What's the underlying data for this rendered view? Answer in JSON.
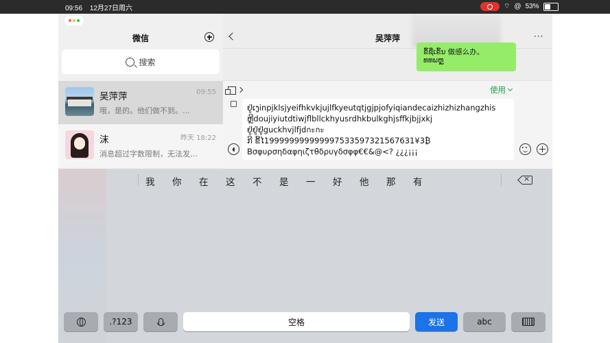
{
  "status_bar": {
    "time": "09:56",
    "date": "12月27日周六",
    "battery": "53%",
    "battery_level": 0.53
  },
  "left_pane": {
    "title": "微信",
    "search_placeholder": "搜索",
    "chats": [
      {
        "name": "吴萍萍",
        "time": "09:55",
        "message": "哦，是的。他们做不到。…",
        "selected": true
      },
      {
        "name": "沫",
        "time": "昨天 18:22",
        "message": "消息超过字数限制，无法发…",
        "selected": false
      }
    ]
  },
  "conversation": {
    "title": "吴萍萍",
    "bubble_lines": [
      "ຂຶ້ຊື່ເຂົ້ນ  做感么办。",
      "ທທພຫຼຼຼຼຼ"
    ],
    "use_label": "使用",
    "input_lines": [
      "ຢູ່ເງinpjklsjyeifhkvkjujlfkyeutqtjgjpjofyiqiandecaizhizhizhangzhis",
      "ຫຼີdoujiyiutdtiwjflbllckhyusrdhkbulkghjsffkjbjjxkj",
      "ຢູ່ຢູ່ຢູ່guckhvjlfjdกะกะ",
      "ກີ ຂີ້ໄ1999999999999975335973215676​31¥3₿",
      "Βσφυρσηδαφηιζτθδρυγδσφφ€€&@<?  ¿¿¿¡¡¡"
    ]
  },
  "keyboard": {
    "candidates": [
      "我",
      "你",
      "在",
      "这",
      "不",
      "是",
      "一",
      "好",
      "他",
      "那",
      "有"
    ],
    "num_key": ".?123",
    "space_key": "空格",
    "send_key": "发送",
    "abc_key": "abc"
  },
  "colors": {
    "accent_green": "#1f9e4c",
    "bubble_green": "#95ec69",
    "send_blue": "#1a73e8"
  }
}
